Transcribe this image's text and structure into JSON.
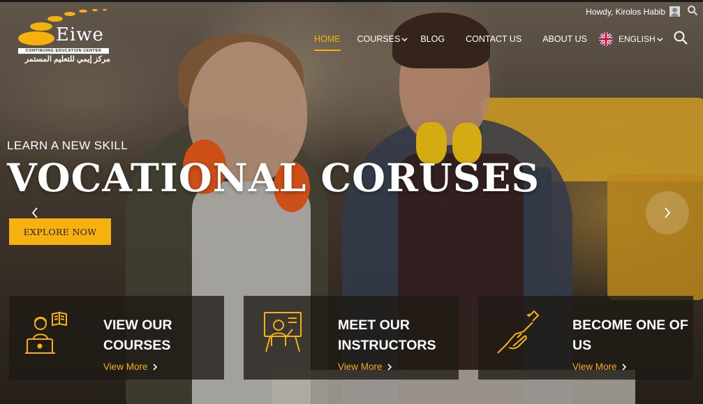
{
  "admin_bar": {
    "greeting": "Howdy, Kirolos Habib"
  },
  "logo": {
    "wordmark": "Eiwe",
    "tagline": "CONTINUING EDUCATION CENTER",
    "arabic": "مركز إيمي للتعليم المستمر"
  },
  "nav": {
    "items": [
      {
        "label": "HOME",
        "active": true
      },
      {
        "label": "COURSES",
        "has_dropdown": true
      },
      {
        "label": "BLOG"
      },
      {
        "label": "CONTACT US"
      },
      {
        "label": "ABOUT US"
      }
    ],
    "language": "ENGLISH"
  },
  "hero": {
    "eyebrow": "LEARN A NEW SKILL",
    "headline": "VOCATIONAL CORUSES",
    "cta": "EXPLORE NOW"
  },
  "cards": [
    {
      "title": "VIEW OUR COURSES",
      "link": "View More",
      "icon": "online-learning-icon"
    },
    {
      "title": "MEET OUR INSTRUCTORS",
      "link": "View More",
      "icon": "instructor-board-icon"
    },
    {
      "title": "BECOME ONE OF US",
      "link": "View More",
      "icon": "handshake-icon"
    }
  ],
  "colors": {
    "accent": "#f6b10f",
    "card_bg": "#1e1914"
  }
}
